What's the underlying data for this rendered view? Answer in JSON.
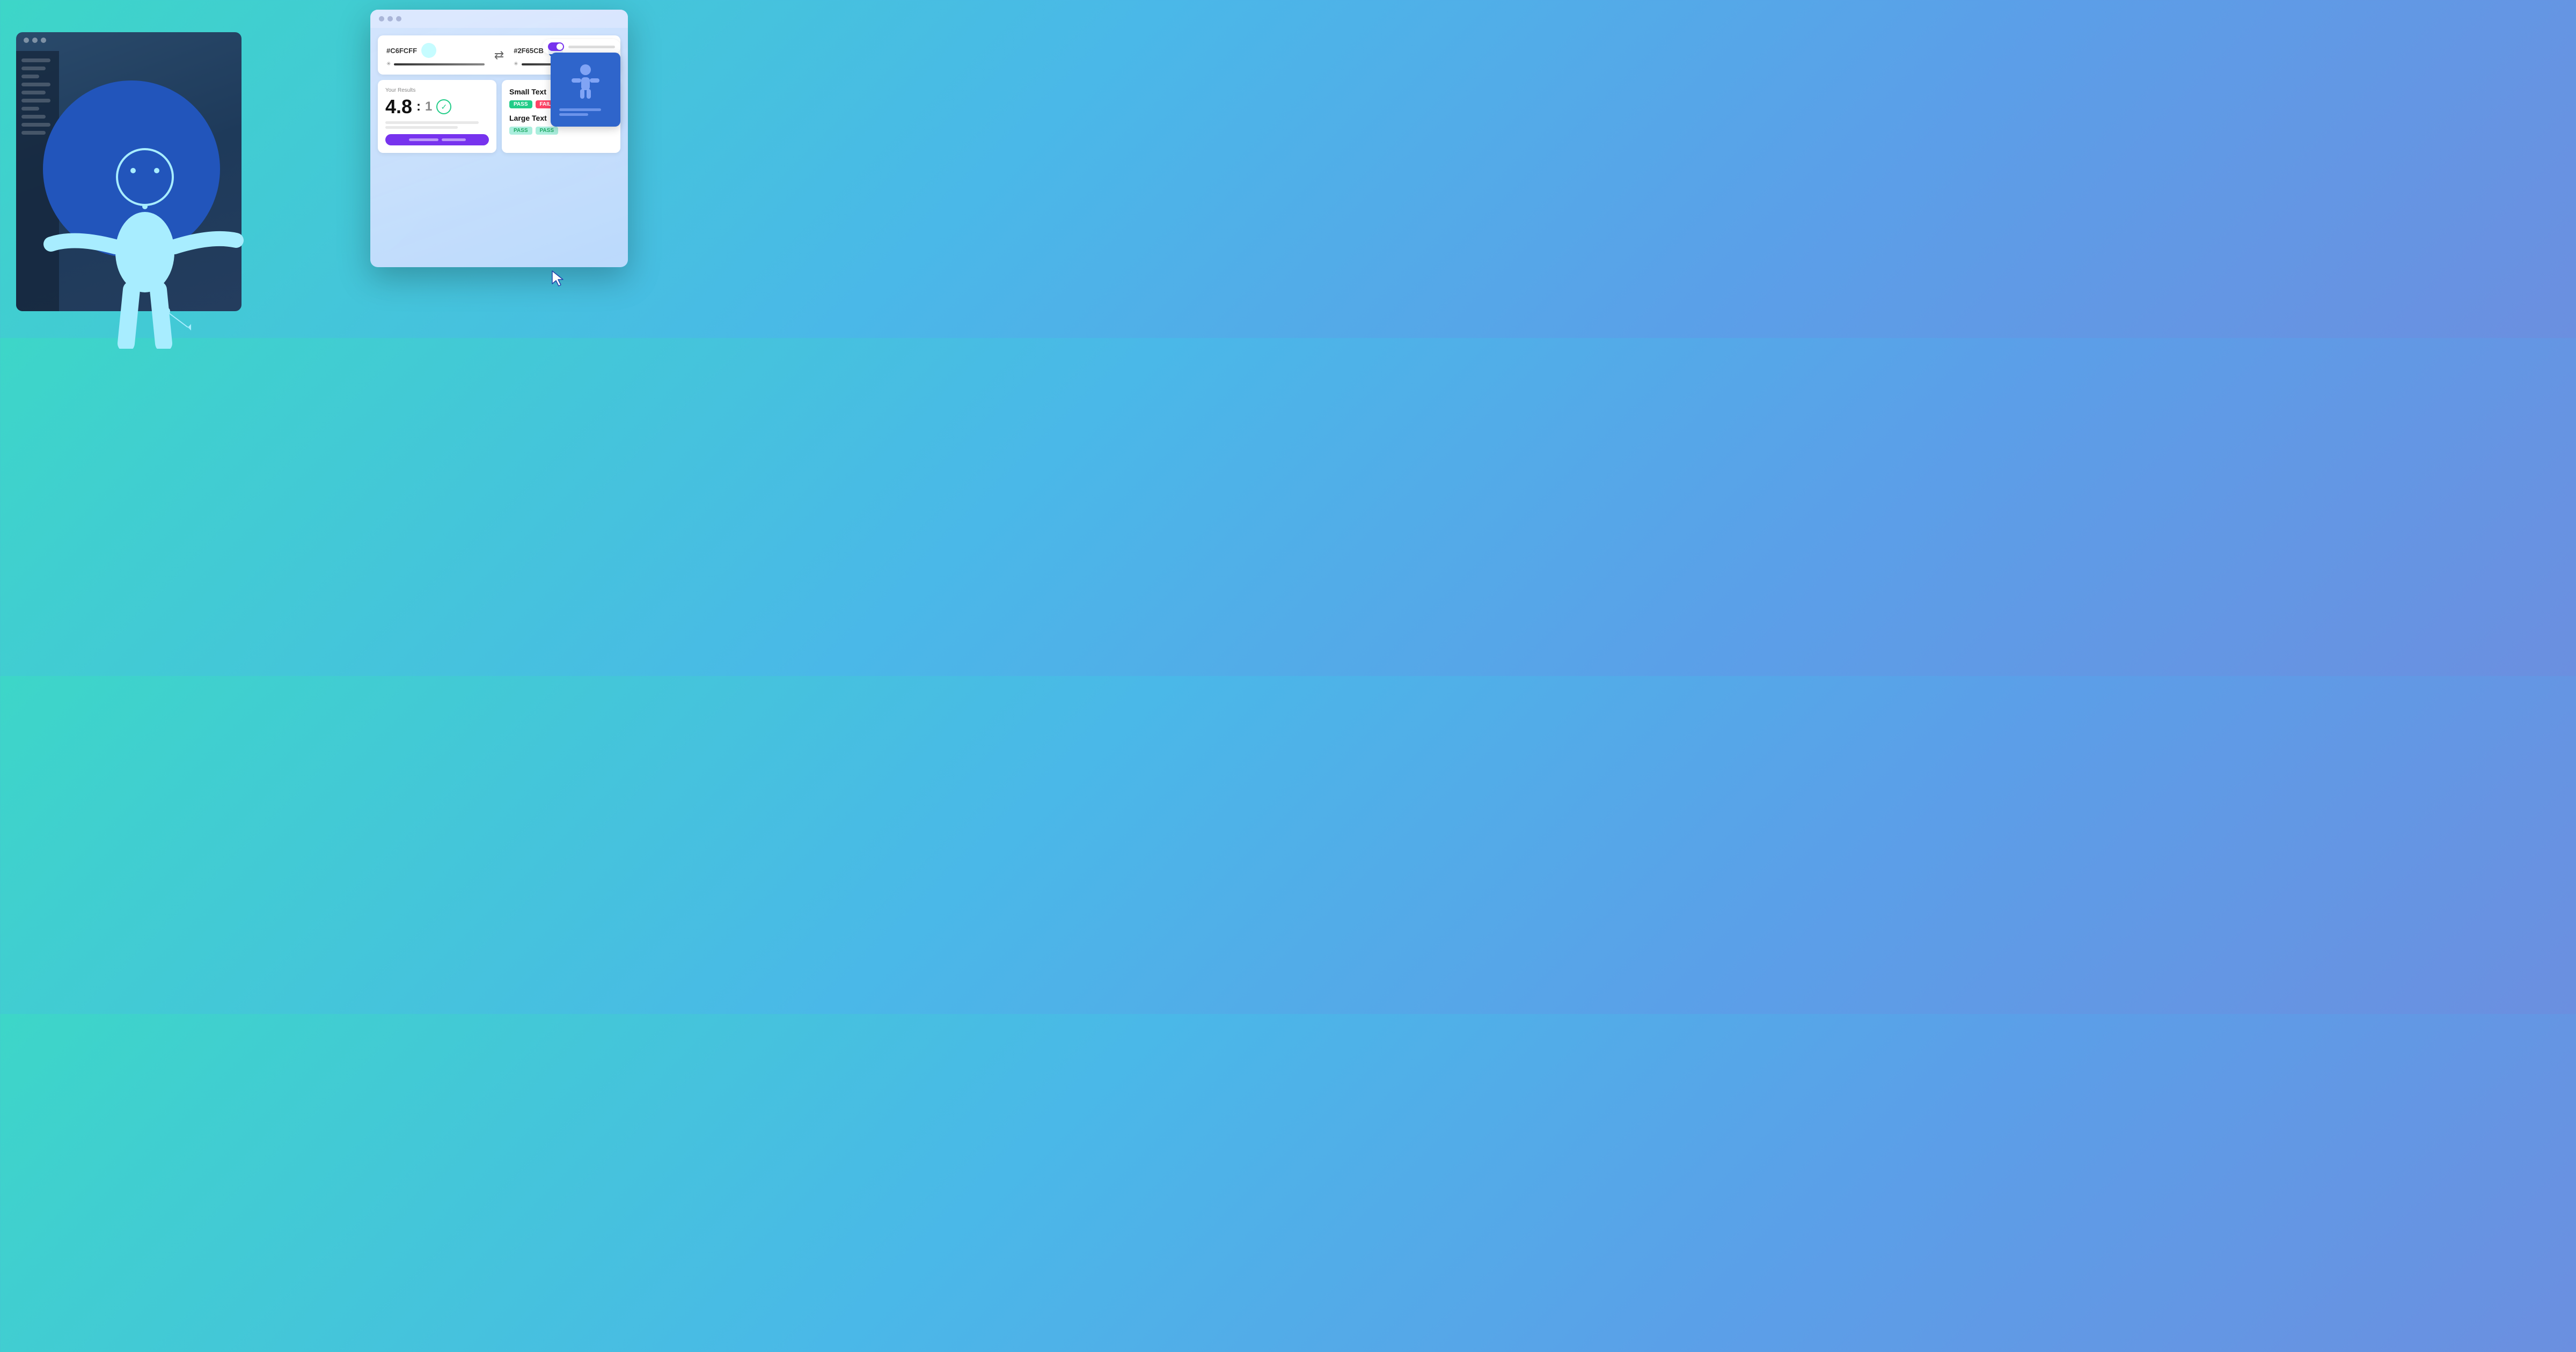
{
  "background": {
    "gradient_start": "#3dd6c8",
    "gradient_end": "#6b8fe0"
  },
  "bg_window": {
    "sidebar_lines": [
      "long",
      "medium",
      "short",
      "long",
      "medium",
      "long",
      "short",
      "medium",
      "long",
      "medium",
      "short",
      "long"
    ]
  },
  "fg_window": {
    "titlebar_dots": 3,
    "color_card": {
      "color1_hex": "#C6FCFF",
      "color1_swatch": "light",
      "color2_hex": "#2F65CB",
      "color2_swatch": "dark",
      "swap_symbol": "⇄"
    },
    "results_card": {
      "label": "Your Results",
      "ratio": "4.8",
      "ratio_suffix": ":1"
    },
    "text_check": {
      "small_text_label": "Small Text",
      "small_badge1": "PASS",
      "small_badge2": "FAIL",
      "large_text_label": "Large Text",
      "large_badge1": "PASS",
      "large_badge2": "PASS"
    }
  },
  "side_panel": {
    "toggle_on": true,
    "access_card_color": "#2F65CB"
  },
  "figure": {
    "body_color": "#a8edff",
    "circle_color": "#2255bb"
  }
}
